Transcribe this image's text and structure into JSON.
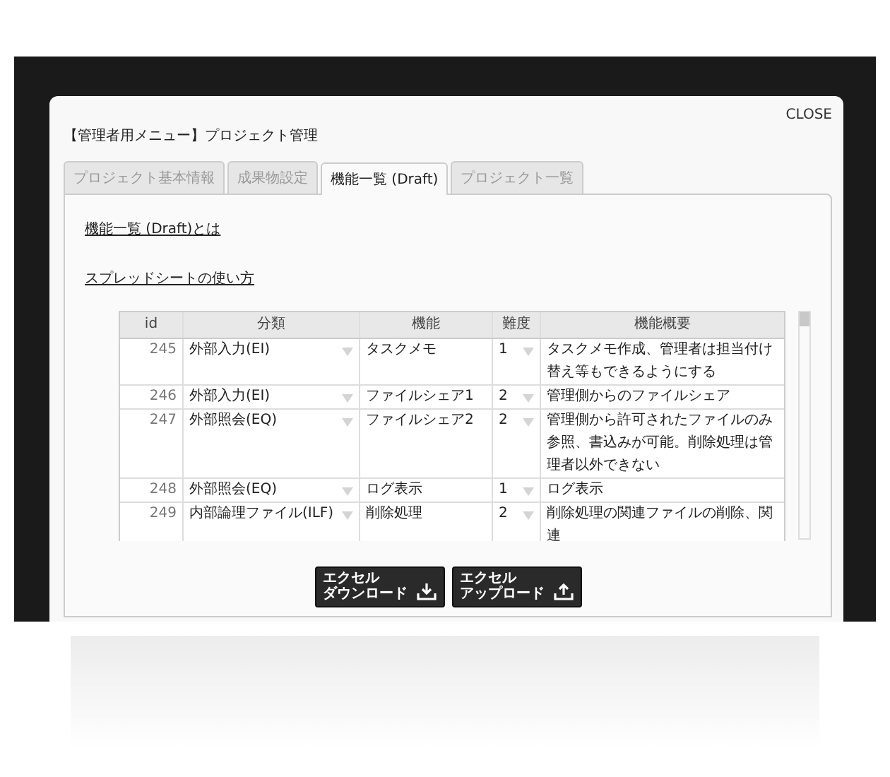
{
  "dialog": {
    "title": "【管理者用メニュー】プロジェクト管理",
    "close": "CLOSE"
  },
  "tabs": [
    {
      "label": "プロジェクト基本情報",
      "selected": false
    },
    {
      "label": "成果物設定",
      "selected": false
    },
    {
      "label": "機能一覧 (Draft)",
      "selected": true
    },
    {
      "label": "プロジェクト一覧",
      "selected": false
    }
  ],
  "links": [
    "機能一覧 (Draft)とは",
    "スプレッドシートの使い方"
  ],
  "table": {
    "columns": [
      "id",
      "分類",
      "機能",
      "難度",
      "機能概要"
    ],
    "rows": [
      {
        "id": "245",
        "category": "外部入力(EI)",
        "function": "タスクメモ",
        "difficulty": "1",
        "summary": "タスクメモ作成、管理者は担当付け替え等もできるようにする"
      },
      {
        "id": "246",
        "category": "外部入力(EI)",
        "function": "ファイルシェア1",
        "difficulty": "2",
        "summary": "管理側からのファイルシェア"
      },
      {
        "id": "247",
        "category": "外部照会(EQ)",
        "function": "ファイルシェア2",
        "difficulty": "2",
        "summary": "管理側から許可されたファイルのみ参照、書込みが可能。削除処理は管理者以外できない"
      },
      {
        "id": "248",
        "category": "外部照会(EQ)",
        "function": "ログ表示",
        "difficulty": "1",
        "summary": "ログ表示"
      },
      {
        "id": "249",
        "category": "内部論理ファイル(ILF)",
        "function": "削除処理",
        "difficulty": "2",
        "summary": "削除処理の関連ファイルの削除、関連"
      }
    ]
  },
  "buttons": [
    {
      "kind": "download",
      "line1": "エクセル",
      "line2": "ダウンロード"
    },
    {
      "kind": "upload",
      "line1": "エクセル",
      "line2": "アップロード"
    }
  ]
}
